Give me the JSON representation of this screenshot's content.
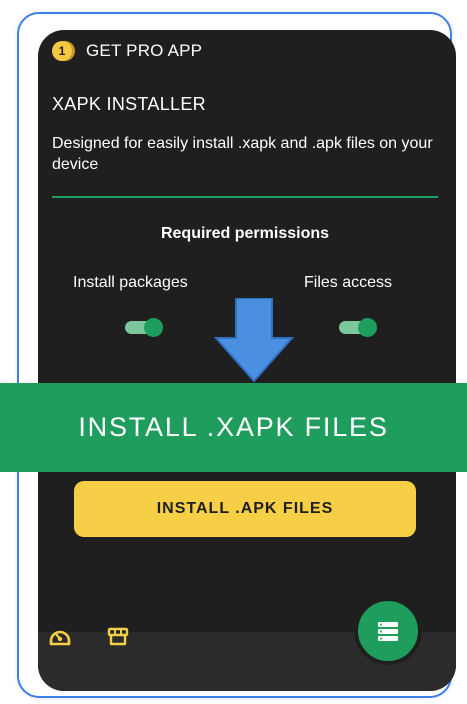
{
  "topbar": {
    "pro_badge": "1",
    "pro_label": "GET PRO APP"
  },
  "header": {
    "title": "XAPK INSTALLER",
    "description": "Designed for easily install .xapk and .apk files on your device"
  },
  "permissions": {
    "title": "Required permissions",
    "items": [
      {
        "label": "Install packages",
        "enabled": true
      },
      {
        "label": "Files access",
        "enabled": true
      }
    ]
  },
  "actions": {
    "install_xapk_label": "INSTALL .XAPK FILES",
    "install_apk_label": "INSTALL .APK FILES"
  },
  "nav": {
    "icons": [
      "dashboard-icon",
      "store-icon"
    ],
    "fab_icon": "list-menu-icon"
  },
  "colors": {
    "accent_green": "#1f9d5c",
    "button_yellow": "#f7cf46",
    "background_dark": "#1f1f1f",
    "arrow_blue": "#4a8fe0",
    "frame_blue": "#3f7ee8"
  }
}
